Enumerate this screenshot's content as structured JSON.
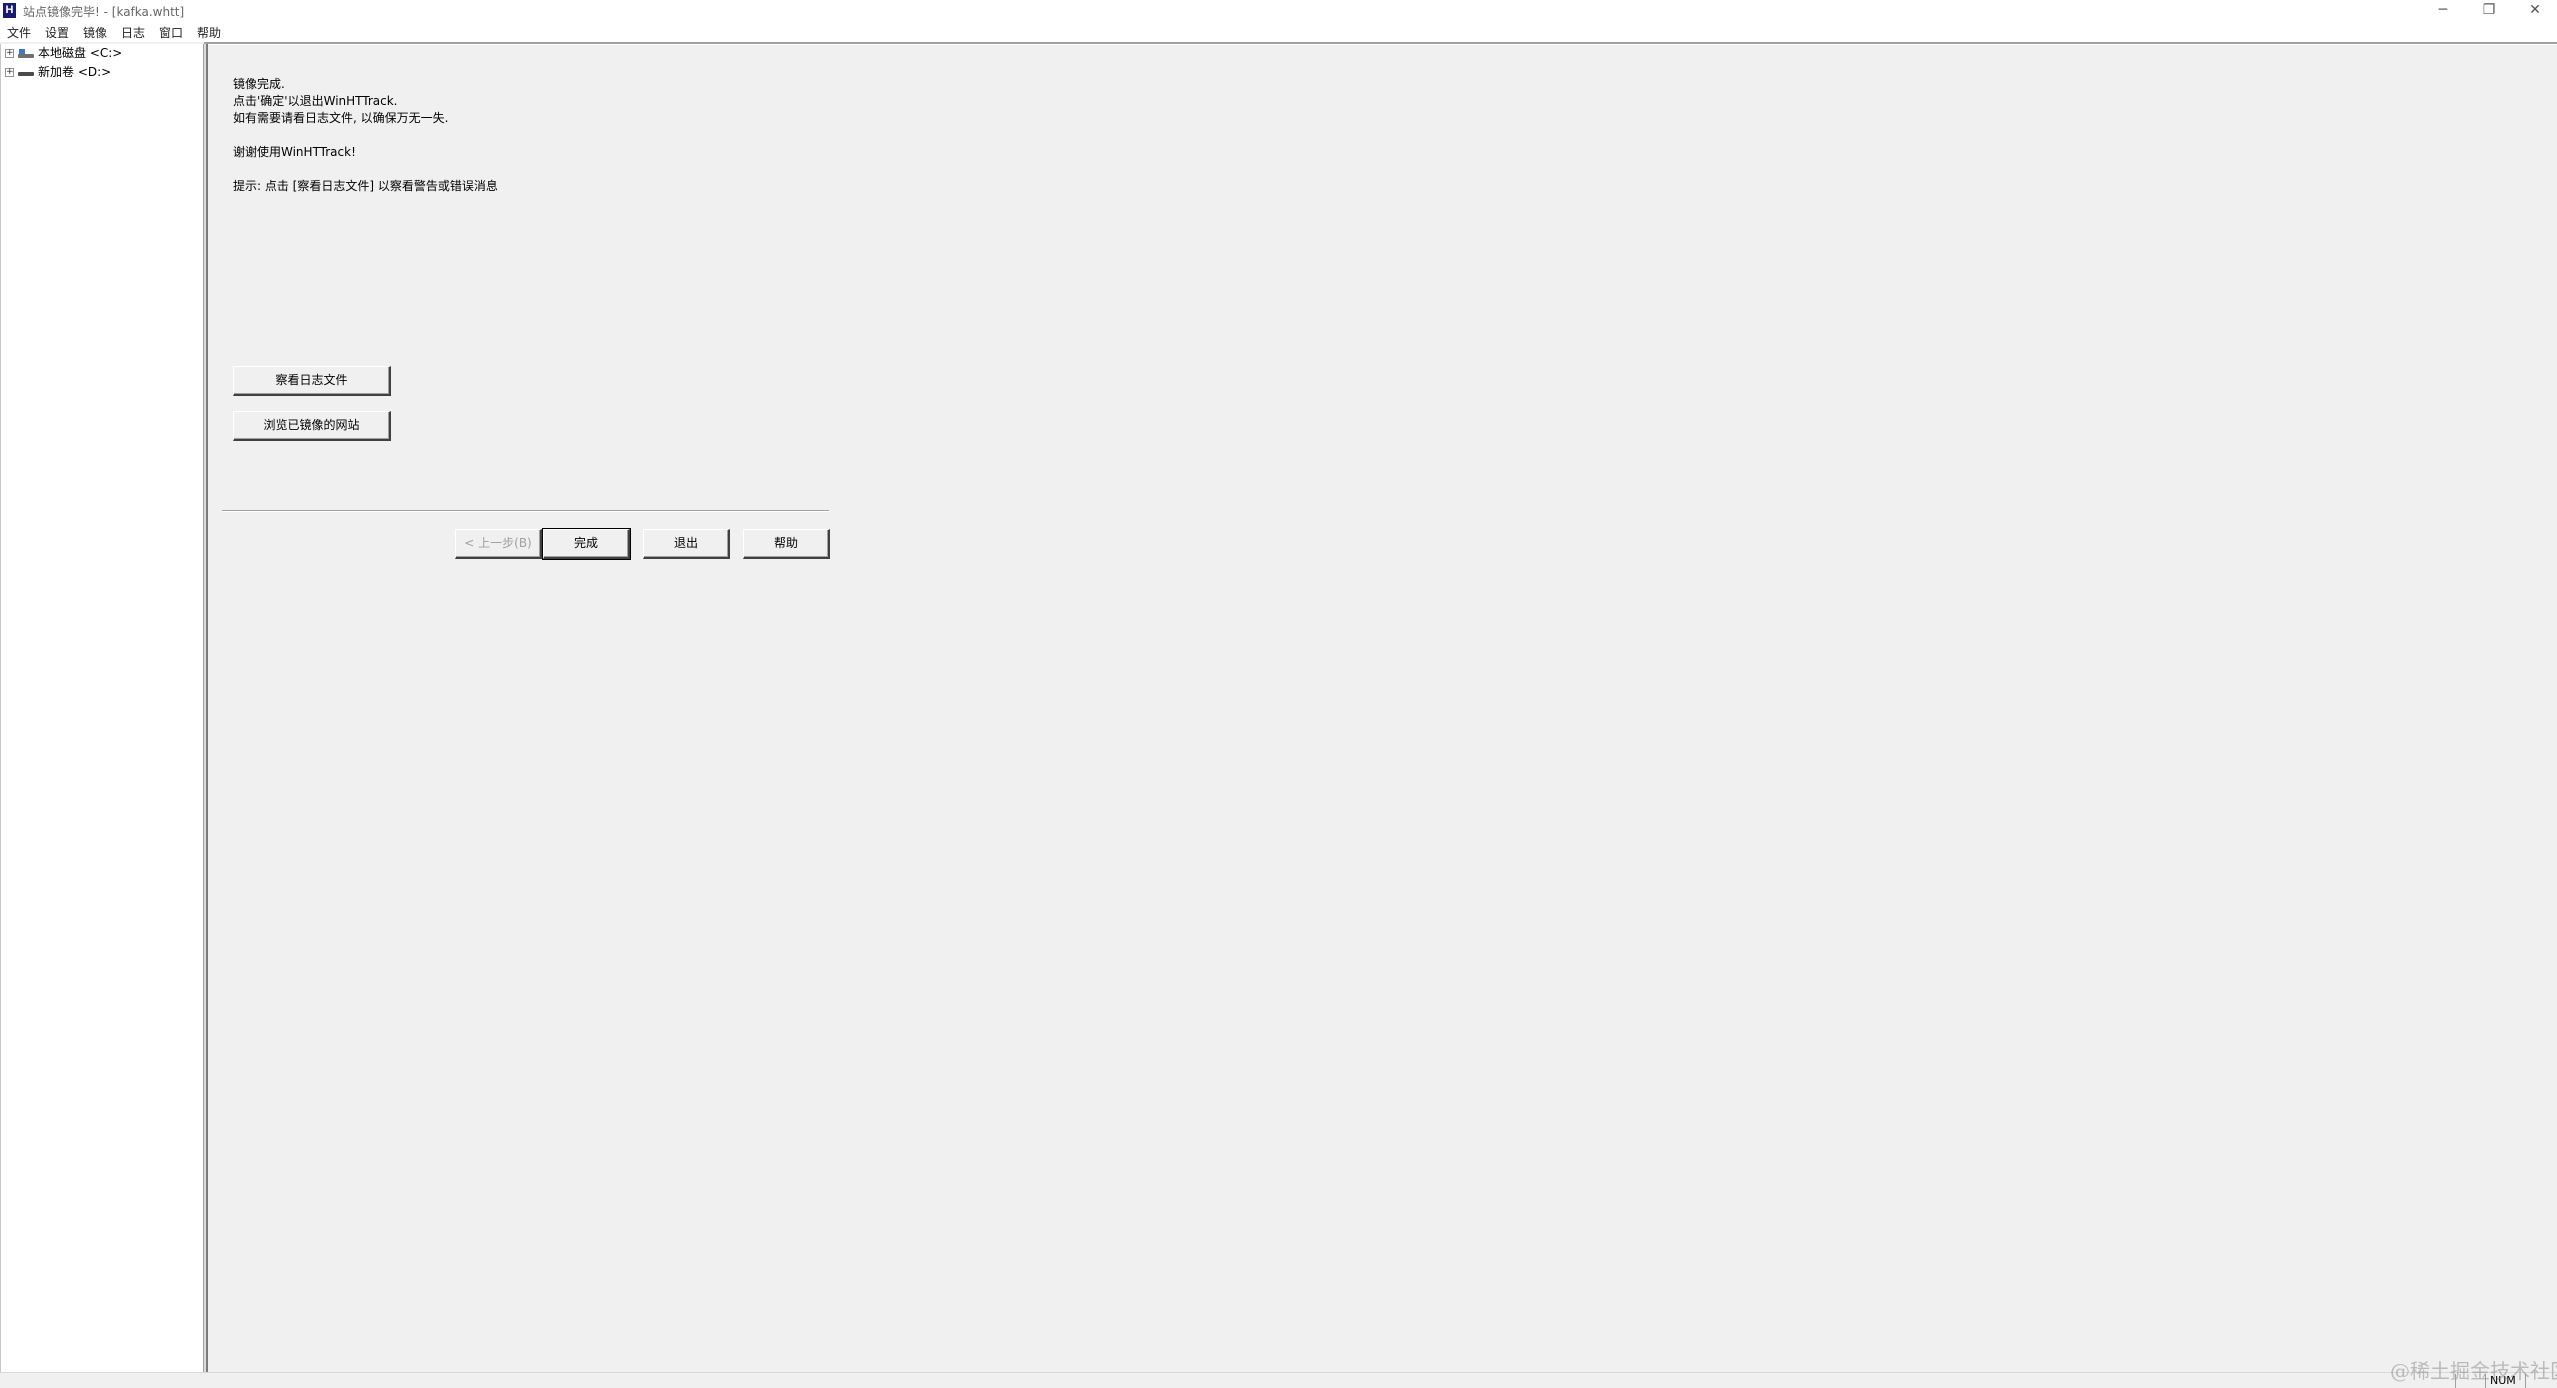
{
  "window": {
    "title": "站点镜像完毕! - [kafka.whtt]",
    "app_icon": "H",
    "minimize_glyph": "─",
    "restore_glyph": "❐",
    "close_glyph": "✕"
  },
  "menu": {
    "items": [
      "文件",
      "设置",
      "镜像",
      "日志",
      "窗口",
      "帮助"
    ]
  },
  "tree": {
    "expander": "+",
    "items": [
      {
        "label": "本地磁盘 <C:>",
        "icon": "system-drive-icon"
      },
      {
        "label": "新加卷 <D:>",
        "icon": "drive-icon"
      }
    ]
  },
  "wizard": {
    "lines": [
      "镜像完成.",
      "点击'确定'以退出WinHTTrack.",
      "如有需要请看日志文件, 以确保万无一失.",
      "谢谢使用WinHTTrack!",
      "提示: 点击 [察看日志文件] 以察看警告或错误消息"
    ],
    "view_log_label": "察看日志文件",
    "browse_site_label": "浏览已镜像的网站",
    "back_label": "< 上一步(B)",
    "finish_label": "完成",
    "exit_label": "退出",
    "help_label": "帮助"
  },
  "status": {
    "num_lock": "NUM"
  },
  "watermark": "@稀土掘金技术社区"
}
